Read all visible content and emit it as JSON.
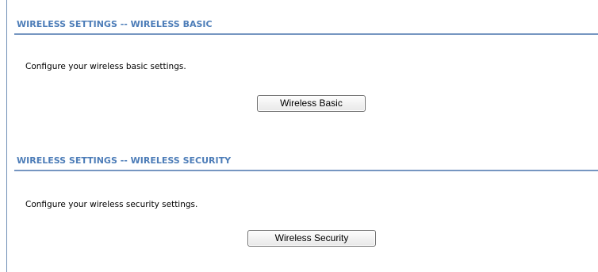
{
  "sections": [
    {
      "title": "WIRELESS SETTINGS -- WIRELESS BASIC",
      "description": "Configure your wireless basic settings.",
      "button_label": "Wireless Basic"
    },
    {
      "title": "WIRELESS SETTINGS -- WIRELESS SECURITY",
      "description": "Configure your wireless security settings.",
      "button_label": "Wireless Security"
    }
  ],
  "colors": {
    "heading": "#4d7db8",
    "rule": "#7696c1"
  }
}
